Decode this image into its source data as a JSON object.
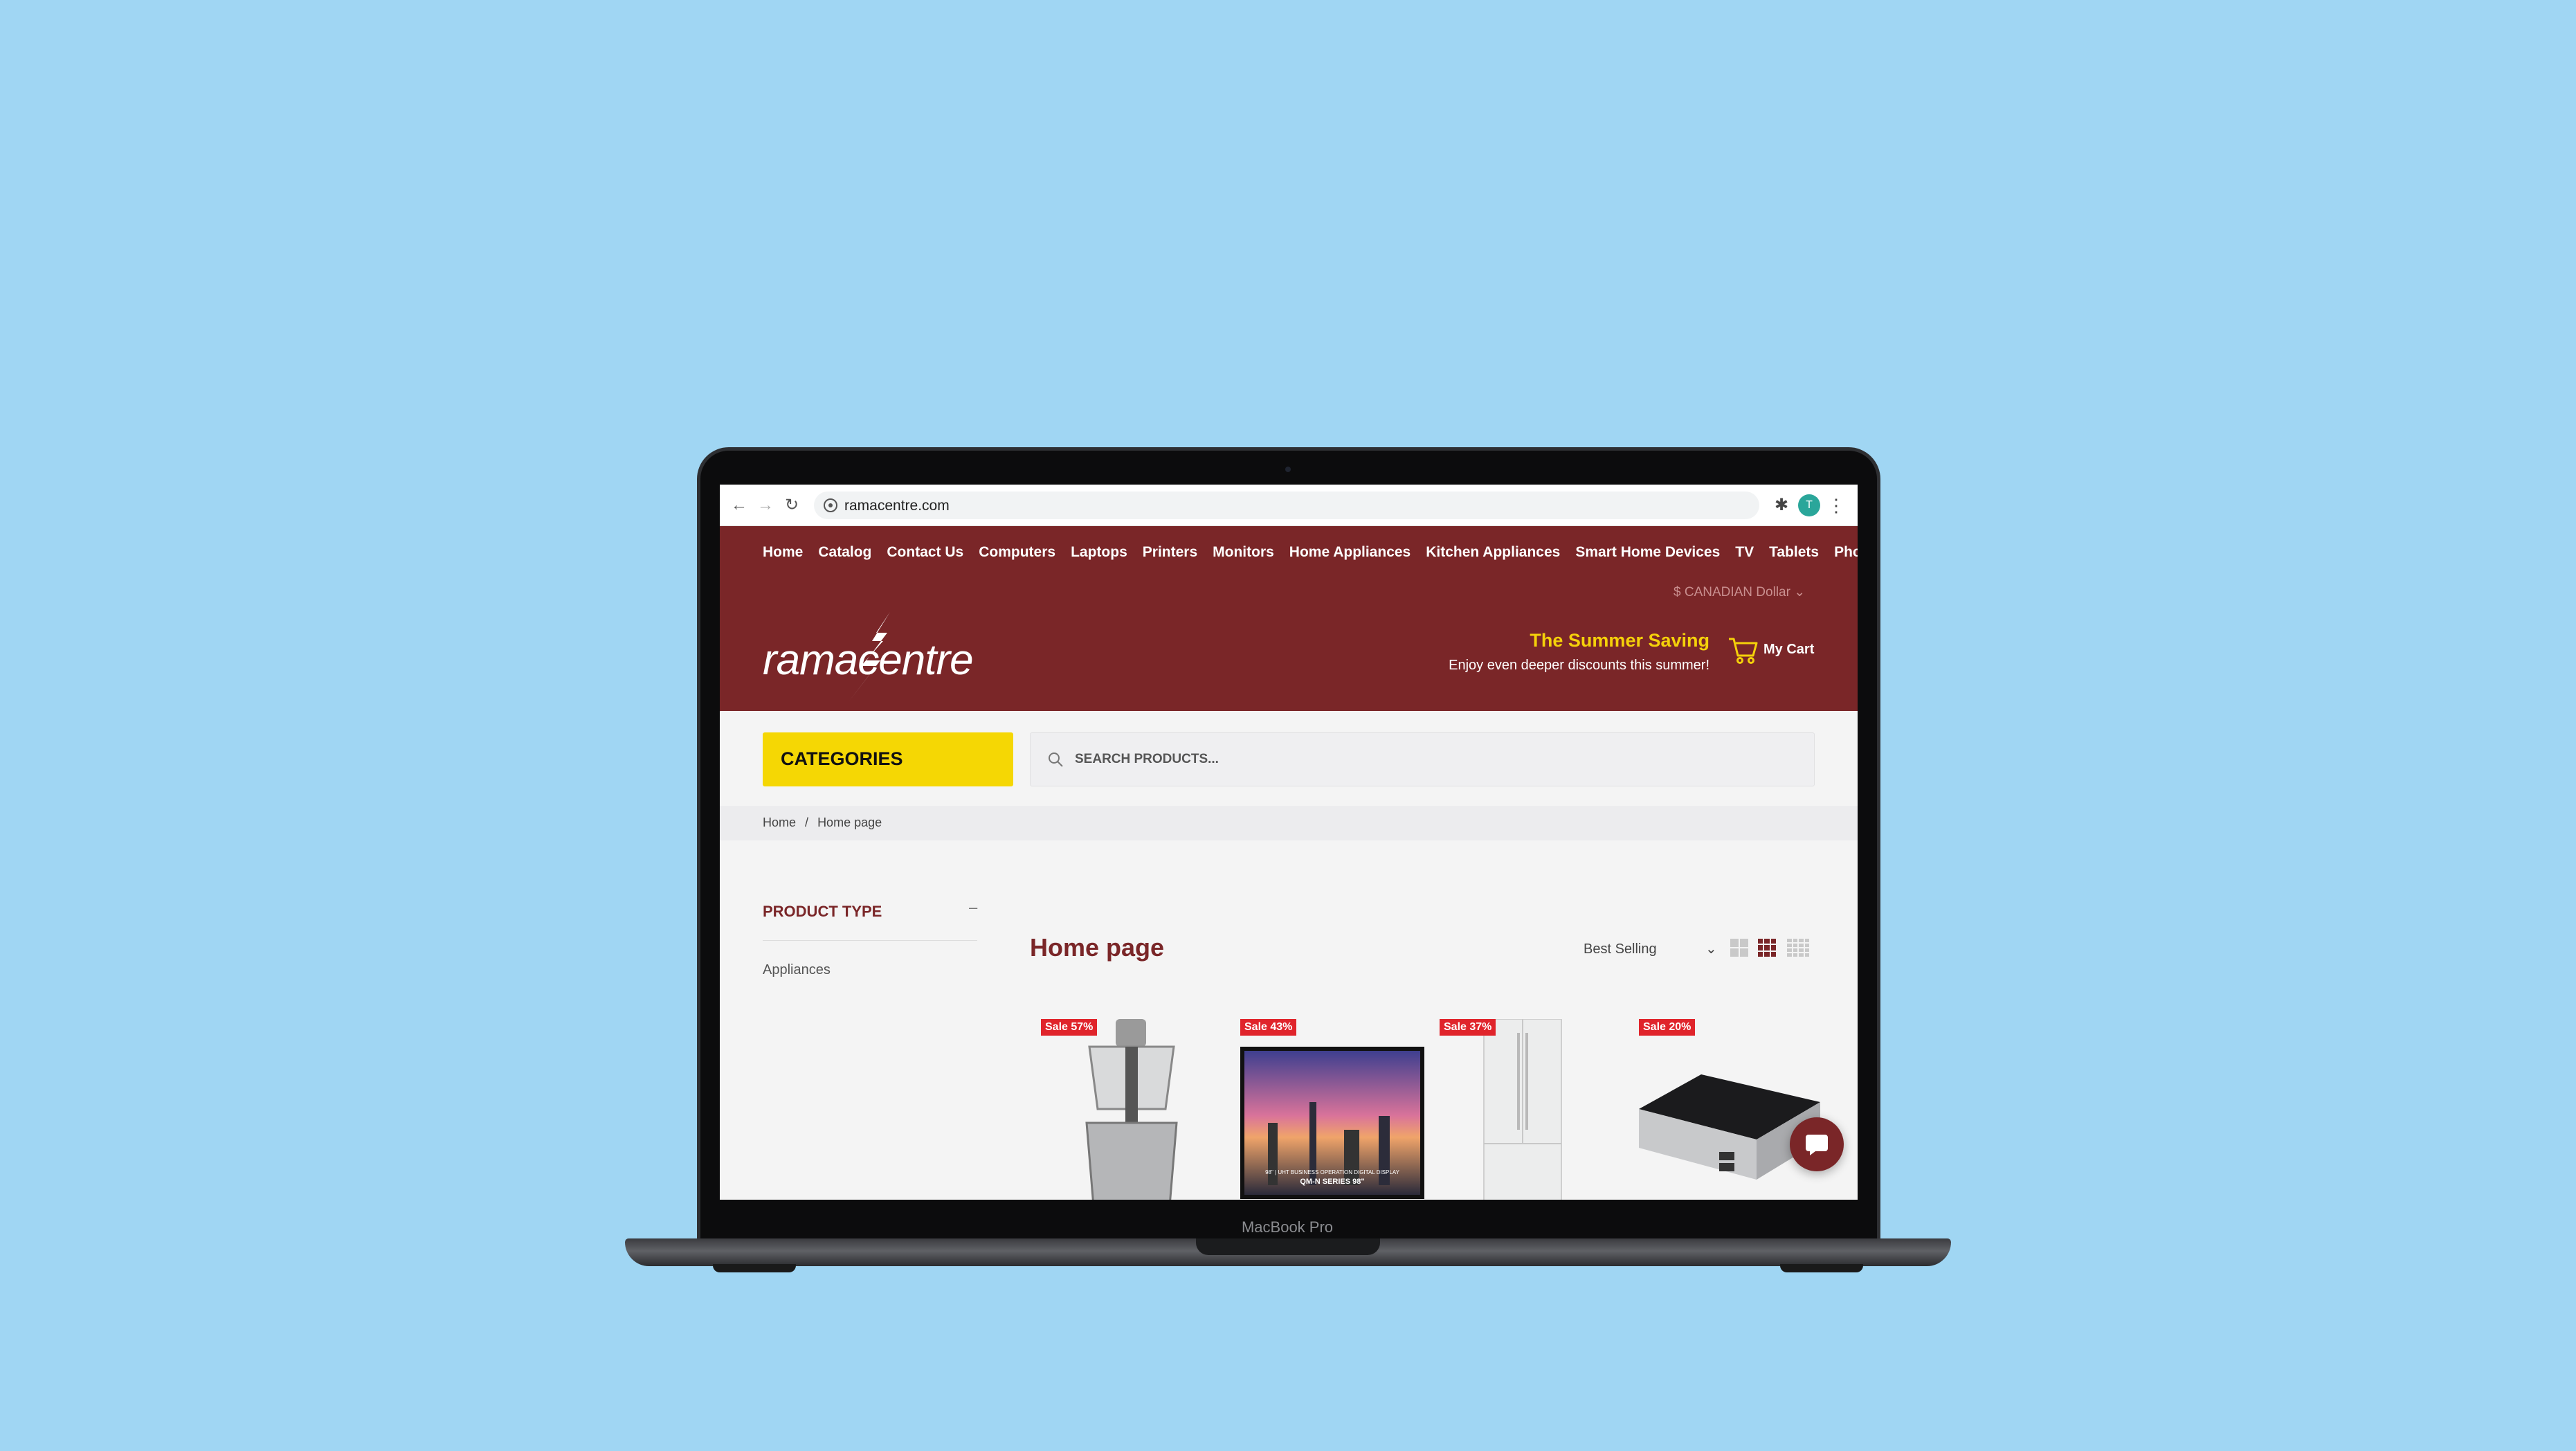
{
  "browser": {
    "url": "ramacentre.com",
    "avatar_initial": "T"
  },
  "site": {
    "nav": [
      "Home",
      "Catalog",
      "Contact Us",
      "Computers",
      "Laptops",
      "Printers",
      "Monitors",
      "Home Appliances",
      "Kitchen Appliances",
      "Smart Home Devices",
      "TV",
      "Tablets",
      "Phones"
    ],
    "currency": "$ CANADIAN Dollar",
    "logo_text": "ramacentre",
    "promo_title": "The Summer Saving",
    "promo_subtitle": "Enjoy even deeper discounts this summer!",
    "cart_label": "My Cart",
    "brand_color": "#7a2628",
    "accent_color": "#f5d704"
  },
  "search": {
    "categories_label": "CATEGORIES",
    "placeholder": "SEARCH PRODUCTS..."
  },
  "breadcrumb": {
    "home": "Home",
    "separator": "/",
    "current": "Home page"
  },
  "sidebar": {
    "filter_title": "PRODUCT TYPE",
    "toggle": "–",
    "items": [
      "Appliances"
    ]
  },
  "main": {
    "heading": "Home page",
    "sort_value": "Best Selling",
    "products": [
      {
        "badge": "Sale 57%",
        "kind": "food-processor"
      },
      {
        "badge": "Sale 43%",
        "kind": "tv",
        "screen_caption_small": "98\" | UHT BUSINESS OPERATION DIGITAL DISPLAY",
        "screen_caption_big": "QM-N SERIES 98\""
      },
      {
        "badge": "Sale 37%",
        "kind": "refrigerator"
      },
      {
        "badge": "Sale 20%",
        "kind": "mini-pc"
      }
    ]
  },
  "device": {
    "label": "MacBook Pro"
  }
}
